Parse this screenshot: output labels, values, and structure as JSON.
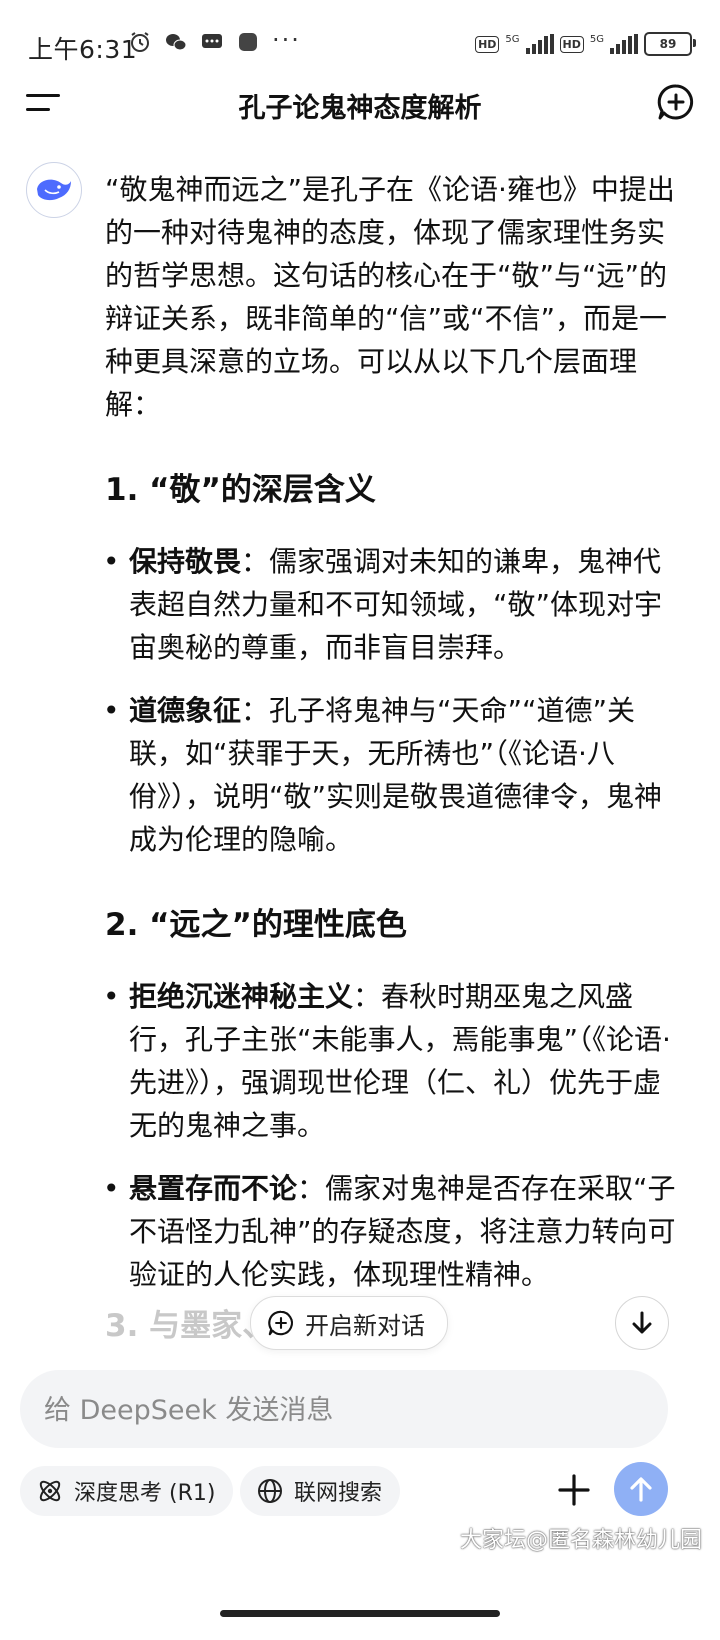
{
  "status_bar": {
    "time": "上午6:31",
    "dots": "···",
    "net1": "5G",
    "net2": "5G",
    "hd": "HD",
    "battery": "89"
  },
  "header": {
    "title": "孔子论鬼神态度解析"
  },
  "message": {
    "intro": "“敬鬼神而远之”是孔子在《论语·雍也》中提出的一种对待鬼神的态度，体现了儒家理性务实的哲学思想。这句话的核心在于“敬”与“远”的辩证关系，既非简单的“信”或“不信”，而是一种更具深意的立场。可以从以下几个层面理解：",
    "sections": [
      {
        "heading": "1. “敬”的深层含义",
        "bullets": [
          {
            "term": "保持敬畏",
            "text": "：儒家强调对未知的谦卑，鬼神代表超自然力量和不可知领域，“敬”体现对宇宙奥秘的尊重，而非盲目崇拜。"
          },
          {
            "term": "道德象征",
            "text": "：孔子将鬼神与“天命”“道德”关联，如“获罪于天，无所祷也”（《论语·八佾》），说明“敬”实则是敬畏道德律令，鬼神成为伦理的隐喻。"
          }
        ]
      },
      {
        "heading": "2. “远之”的理性底色",
        "bullets": [
          {
            "term": "拒绝沉迷神秘主义",
            "text": "：春秋时期巫鬼之风盛行，孔子主张“未能事人，焉能事鬼”（《论语·先进》），强调现世伦理（仁、礼）优先于虚无的鬼神之事。"
          },
          {
            "term": "悬置存而不论",
            "text": "：儒家对鬼神是否存在采取“子不语怪力乱神”的存疑态度，将注意力转向可验证的人伦实践，体现理性精神。"
          }
        ]
      }
    ],
    "next_heading_partial": "3. 与墨家、"
  },
  "floating": {
    "new_chat_label": "开启新对话"
  },
  "composer": {
    "placeholder": "给 DeepSeek 发送消息",
    "deep_think_label": "深度思考 (R1)",
    "web_search_label": "联网搜索"
  },
  "watermark": "大家坛@匿名森林幼儿园",
  "colors": {
    "accent": "#4d6bfe",
    "send_button": "#8fb0f5"
  }
}
